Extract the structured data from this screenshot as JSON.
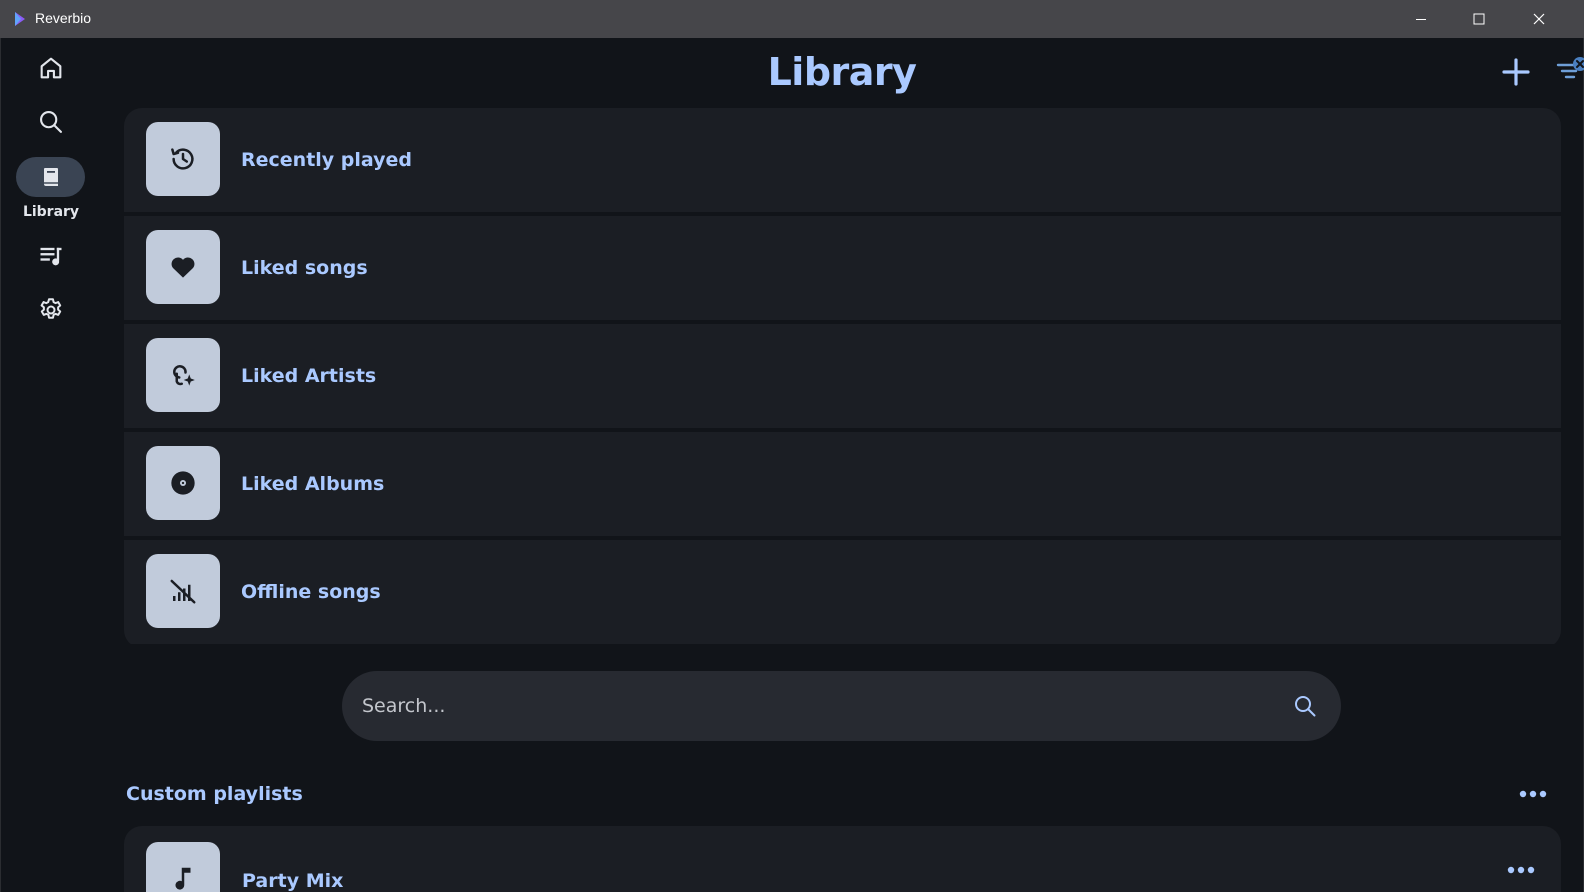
{
  "window": {
    "title": "Reverbio",
    "minimize_icon": "minimize-icon",
    "maximize_icon": "maximize-icon",
    "close_icon": "close-icon"
  },
  "nav": {
    "items": [
      {
        "name": "home",
        "icon": "home-icon"
      },
      {
        "name": "search",
        "icon": "search-icon"
      },
      {
        "name": "library",
        "icon": "book-icon",
        "label": "Library",
        "active": true
      },
      {
        "name": "queue",
        "icon": "queue-music-icon"
      },
      {
        "name": "settings",
        "icon": "gear-icon"
      }
    ]
  },
  "header": {
    "title": "Library",
    "add_icon": "plus-icon",
    "filter_icon": "filter-clear-icon"
  },
  "library": {
    "items": [
      {
        "label": "Recently played",
        "icon": "history-icon"
      },
      {
        "label": "Liked songs",
        "icon": "heart-icon"
      },
      {
        "label": "Liked Artists",
        "icon": "artist-mic-icon"
      },
      {
        "label": "Liked Albums",
        "icon": "album-disc-icon"
      },
      {
        "label": "Offline songs",
        "icon": "signal-off-icon"
      }
    ]
  },
  "search": {
    "placeholder": "Search...",
    "value": ""
  },
  "custom_playlists": {
    "title": "Custom playlists",
    "items": [
      {
        "label": "Party Mix",
        "icon": "music-note-icon"
      }
    ]
  },
  "colors": {
    "background": "#111419",
    "surface": "#1b1e24",
    "accent": "#aac9ff",
    "thumb": "#c1cbdb",
    "titlebar": "#46464a"
  }
}
